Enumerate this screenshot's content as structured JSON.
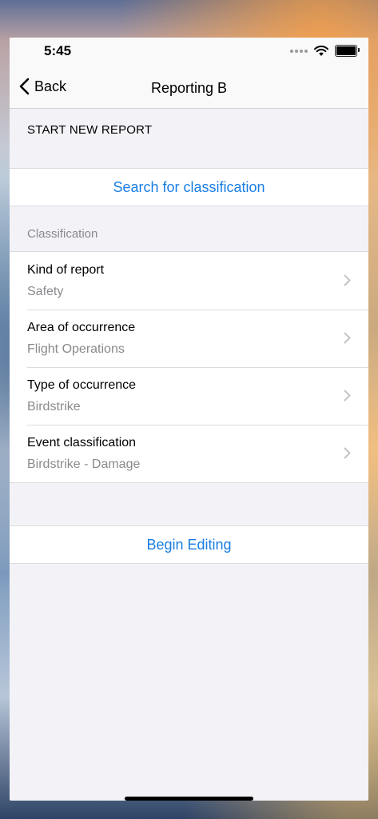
{
  "status_bar": {
    "time": "5:45",
    "icons": [
      "signal-dots-icon",
      "wifi-icon",
      "battery-icon"
    ]
  },
  "nav": {
    "back_label": "Back",
    "title": "Reporting B",
    "back_icon": "chevron-left-icon"
  },
  "sections": {
    "start_header": "START NEW REPORT",
    "search_button": "Search for classification",
    "classification_header": "Classification"
  },
  "classification_rows": [
    {
      "title": "Kind of report",
      "value": "Safety"
    },
    {
      "title": "Area of occurrence",
      "value": "Flight Operations"
    },
    {
      "title": "Type of occurrence",
      "value": "Birdstrike"
    },
    {
      "title": "Event classification",
      "value": "Birdstrike - Damage"
    }
  ],
  "begin_editing_button": "Begin Editing",
  "colors": {
    "accent": "#1a7ee3",
    "background": "#f2f2f7",
    "secondary_text": "#8a8a8e"
  }
}
